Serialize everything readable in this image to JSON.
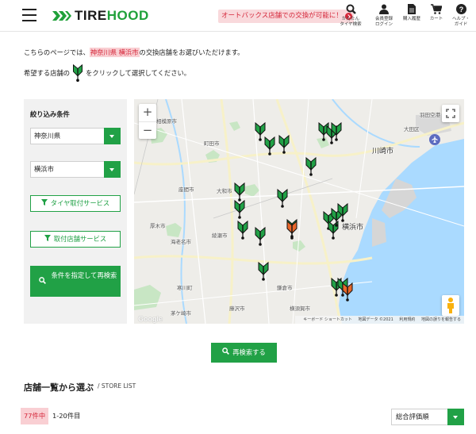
{
  "header": {
    "logo": {
      "part1": "TIRE",
      "part2": "HOOD"
    },
    "promo": "オートバックス店舗での交換が可能に！",
    "nav": [
      {
        "id": "search",
        "label1": "かんたん",
        "label2": "タイヤ検索",
        "icon": "search-icon"
      },
      {
        "id": "account",
        "label1": "会員登録",
        "label2": "ログイン",
        "icon": "user-icon"
      },
      {
        "id": "history",
        "label1": "",
        "label2": "購入履歴",
        "icon": "document-icon"
      },
      {
        "id": "cart",
        "label1": "",
        "label2": "カート",
        "icon": "cart-icon"
      },
      {
        "id": "help",
        "label1": "ヘルプ・",
        "label2": "ガイド",
        "icon": "help-icon"
      }
    ]
  },
  "intro": {
    "line1_pre": "こちらのページでは、",
    "line1_highlight": "神奈川県 横浜市",
    "line1_post": "の交換店舗をお選びいただけます。",
    "line2_pre": "希望する店舗の",
    "line2_post": "をクリックして選択してください。"
  },
  "filter": {
    "title": "絞り込み条件",
    "prefecture": "神奈川県",
    "city": "横浜市",
    "service1": "タイヤ取付サービス",
    "service2": "取付店舗サービス",
    "submit": "条件を指定して再検索"
  },
  "map": {
    "labels": [
      "相模原市",
      "町田市",
      "座間市",
      "大和市",
      "厚木市",
      "海老名市",
      "綾瀬市",
      "横浜市",
      "川崎市",
      "藤沢市",
      "茅ケ崎市",
      "大田区",
      "羽田空港",
      "横須賀市",
      "鎌倉市",
      "寒川町"
    ],
    "attribution": {
      "google": "Google",
      "shortcuts": "キーボード ショートカット",
      "data": "地図データ ©2021",
      "terms": "利用規約",
      "report": "地図の誤りを報告する"
    },
    "markers": [
      {
        "type": "green"
      },
      {
        "type": "green"
      },
      {
        "type": "green"
      },
      {
        "type": "green"
      },
      {
        "type": "green"
      },
      {
        "type": "green"
      },
      {
        "type": "green"
      },
      {
        "type": "green"
      },
      {
        "type": "green"
      },
      {
        "type": "green"
      },
      {
        "type": "green"
      },
      {
        "type": "green"
      },
      {
        "type": "green"
      },
      {
        "type": "orange"
      },
      {
        "type": "green"
      },
      {
        "type": "green"
      },
      {
        "type": "green"
      },
      {
        "type": "green"
      },
      {
        "type": "green"
      },
      {
        "type": "green"
      },
      {
        "type": "green"
      },
      {
        "type": "orange"
      }
    ],
    "zoom_in": "+",
    "zoom_out": "−"
  },
  "research": "再検索する",
  "store_list": {
    "title": "店舗一覧から選ぶ",
    "subtitle": "/ STORE LIST",
    "count": "77件中",
    "range": "1-20件目",
    "sort": "総合評価順"
  },
  "colors": {
    "green": "#21a146",
    "orange": "#e8672a",
    "pink": "#f9cfd3",
    "red": "#d5283b"
  }
}
